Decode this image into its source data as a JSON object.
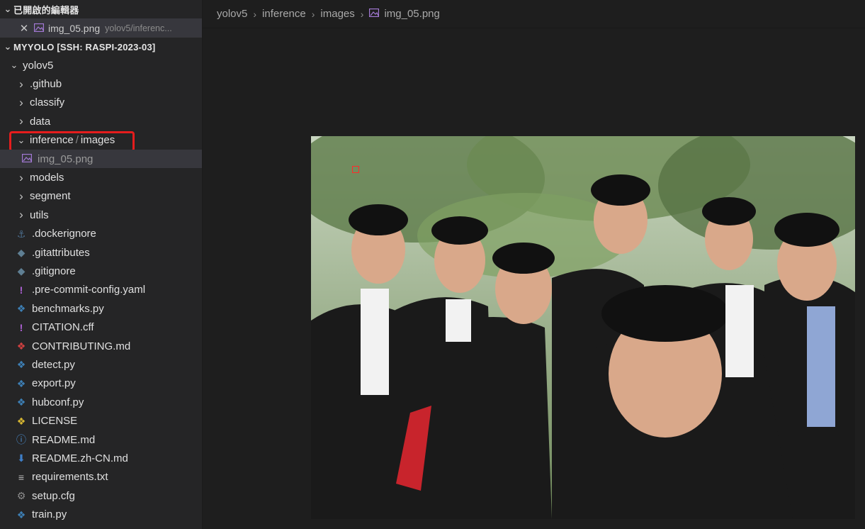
{
  "sidebar": {
    "open_editors_title": "已開啟的編輯器",
    "open_editor": {
      "name": "img_05.png",
      "path": "yolov5/inferenc..."
    },
    "workspace_title": "MYYOLO [SSH: RASPI-2023-03]",
    "tree": [
      {
        "label": "yolov5",
        "type": "folder-open",
        "indent": 1
      },
      {
        "label": ".github",
        "type": "folder",
        "indent": 2
      },
      {
        "label": "classify",
        "type": "folder",
        "indent": 2
      },
      {
        "label": "data",
        "type": "folder",
        "indent": 2
      },
      {
        "label": "inference",
        "label2": "images",
        "type": "folder-open",
        "indent": 2,
        "highlighted": true
      },
      {
        "label": "img_05.png",
        "type": "image",
        "indent": 3,
        "selected": true
      },
      {
        "label": "models",
        "type": "folder",
        "indent": 2
      },
      {
        "label": "segment",
        "type": "folder",
        "indent": 2
      },
      {
        "label": "utils",
        "type": "folder",
        "indent": 2
      },
      {
        "label": ".dockerignore",
        "type": "docker",
        "indent": 2
      },
      {
        "label": ".gitattributes",
        "type": "git",
        "indent": 2
      },
      {
        "label": ".gitignore",
        "type": "git",
        "indent": 2
      },
      {
        "label": ".pre-commit-config.yaml",
        "type": "yaml",
        "indent": 2
      },
      {
        "label": "benchmarks.py",
        "type": "python",
        "indent": 2
      },
      {
        "label": "CITATION.cff",
        "type": "yaml",
        "indent": 2
      },
      {
        "label": "CONTRIBUTING.md",
        "type": "ribbon",
        "indent": 2
      },
      {
        "label": "detect.py",
        "type": "python",
        "indent": 2
      },
      {
        "label": "export.py",
        "type": "python",
        "indent": 2
      },
      {
        "label": "hubconf.py",
        "type": "python",
        "indent": 2
      },
      {
        "label": "LICENSE",
        "type": "license",
        "indent": 2
      },
      {
        "label": "README.md",
        "type": "info",
        "indent": 2
      },
      {
        "label": "README.zh-CN.md",
        "type": "download",
        "indent": 2
      },
      {
        "label": "requirements.txt",
        "type": "text",
        "indent": 2
      },
      {
        "label": "setup.cfg",
        "type": "gear",
        "indent": 2
      },
      {
        "label": "train.py",
        "type": "python",
        "indent": 2
      }
    ]
  },
  "breadcrumb": {
    "items": [
      "yolov5",
      "inference",
      "images"
    ],
    "file": "img_05.png"
  },
  "icons": {
    "folder-open": "chevron-down-icon",
    "folder": "chevron-right-icon",
    "image": "image-icon",
    "docker": "docker-icon",
    "git": "git-icon",
    "yaml": "exclamation-icon",
    "python": "python-icon",
    "ribbon": "ribbon-icon",
    "license": "license-icon",
    "info": "info-icon",
    "download": "download-icon",
    "text": "text-lines-icon",
    "gear": "gear-icon"
  },
  "colors": {
    "highlight": "#e51d1d",
    "python": "#3d7fb5",
    "yaml": "#b062d8",
    "image": "#a47ad6"
  }
}
